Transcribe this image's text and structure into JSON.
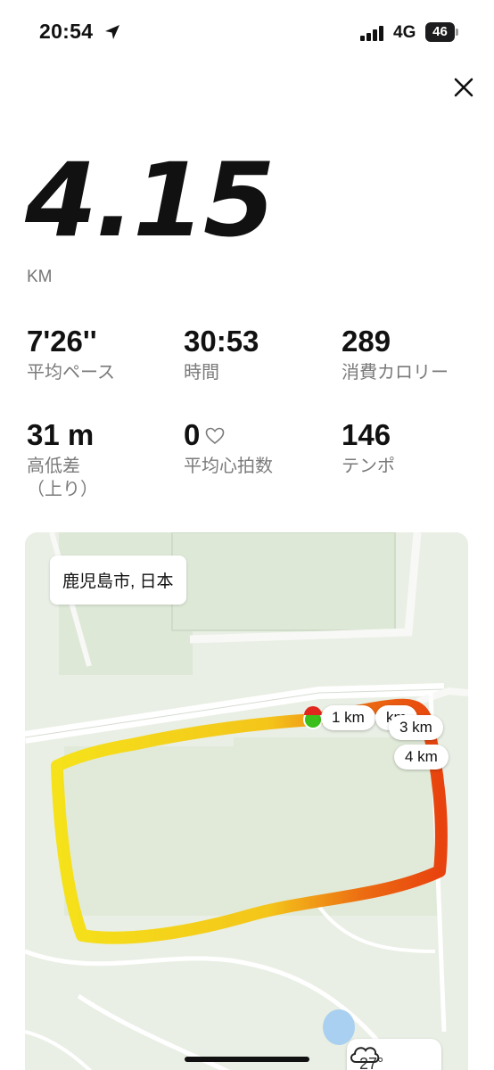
{
  "status_bar": {
    "time": "20:54",
    "network": "4G",
    "battery": "46"
  },
  "summary": {
    "distance": "4.15",
    "distance_unit": "KM"
  },
  "stats": [
    {
      "value": "7'26''",
      "label": "平均ペース"
    },
    {
      "value": "30:53",
      "label": "時間"
    },
    {
      "value": "289",
      "label": "消費カロリー"
    },
    {
      "value": "31 m",
      "label": "高低差\n（上り）"
    },
    {
      "value": "0",
      "label": "平均心拍数"
    },
    {
      "value": "146",
      "label": "テンポ"
    }
  ],
  "map": {
    "location": "鹿児島市, 日本",
    "markers": [
      "1 km",
      "km",
      "3 km",
      "4 km"
    ],
    "weather_temp": "27°"
  },
  "colors": {
    "route_slow": "#f5e21a",
    "route_fast": "#e8420e",
    "start_marker": "#3bbf1a"
  },
  "icons": {
    "close": "close-icon",
    "heart": "heart-icon",
    "location_arrow": "location-arrow-icon",
    "weather": "cloud-icon"
  }
}
